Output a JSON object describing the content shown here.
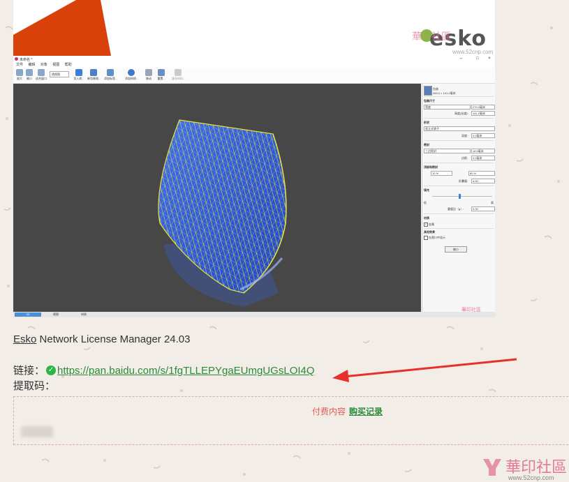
{
  "banner": {
    "logo_text": "esko"
  },
  "watermark_top": {
    "text": "華印社區",
    "url": "www.52cnp.com"
  },
  "app": {
    "title": "未命名 *",
    "menu": [
      "文件",
      "编辑",
      "对象",
      "视图",
      "帮助"
    ],
    "toolbar": [
      {
        "label": "放大",
        "icon": "zoom-in-icon"
      },
      {
        "label": "缩小",
        "icon": "zoom-out-icon"
      },
      {
        "label": "适合窗口",
        "icon": "zoom-fit-icon"
      },
      {
        "label": "导入底...",
        "icon": "import-icon"
      },
      {
        "label": "新包装袋...",
        "icon": "new-bag-icon"
      },
      {
        "label": "添加标签...",
        "icon": "add-label-icon"
      },
      {
        "label": "添加材质...",
        "icon": "add-material-icon"
      },
      {
        "label": "移动",
        "icon": "move-icon"
      },
      {
        "label": "重置...",
        "icon": "reset-icon"
      },
      {
        "label": "填充材料...",
        "icon": "fill-icon"
      }
    ],
    "view_select": "透视图",
    "window_controls": [
      "–",
      "□",
      "×"
    ],
    "status_tabs": [
      "3D",
      "视图",
      "材质"
    ],
    "panel": {
      "item_name": "包装",
      "item_size": "269.0 × 141.2毫米",
      "sections": {
        "size": "包装尺寸",
        "shape": "形状",
        "seal": "密封",
        "top_seal": "顶部和密封",
        "fill": "填充",
        "material": "材质",
        "effects": "其他效果"
      },
      "fields": {
        "width_mode": "宽度",
        "width_val": "270.0毫米",
        "height_label": "高度(长度):",
        "height_val": "141.2毫米",
        "shape_val": "直立式袋子",
        "depth_label": "深度:",
        "depth_val": "0.0毫米",
        "seal_val": "三边密封",
        "seal_w_val": "16.5毫米",
        "gusset_label": "边距:",
        "gusset_val": "0.0毫米",
        "pct1": "10 %",
        "pct2": "60 %",
        "fold_label": "折叠量:",
        "fold_val": "4.00",
        "fill_low": "低",
        "fill_high": "高",
        "fill_spin": "0.0",
        "density_label": "重量比（g）:",
        "density_val": "0.30",
        "material_chk": "金属",
        "effect_chk": "在视口中显示",
        "apply_btn": "缩小"
      }
    },
    "watermark": "華印社區"
  },
  "product": {
    "brand": "Esko",
    "name_rest": " Network License Manager 24.03"
  },
  "link": {
    "label": "链接：",
    "url": "https://pan.baidu.com/s/1fgTLLEPYgaEUmgUGsLOI4Q"
  },
  "code": {
    "label": "提取码："
  },
  "paid": {
    "text": "付费内容",
    "buy": "购买记录"
  },
  "watermark_bottom": {
    "text": "華印社區",
    "url": "www.52cnp.com"
  },
  "colors": {
    "accent_red": "#e05a5a",
    "link_green": "#2a8a3a",
    "bag_blue": "#2f5fe0",
    "mesh_yellow": "#e8e23a",
    "banner_orange": "#d9410a"
  }
}
